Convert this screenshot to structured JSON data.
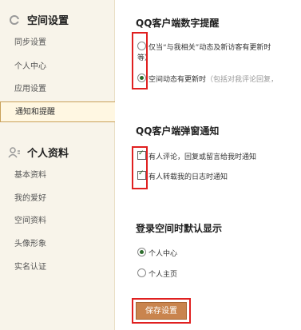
{
  "sidebar": {
    "space_settings": {
      "title": "空间设置",
      "items": [
        "同步设置",
        "个人中心",
        "应用设置",
        "通知和提醒"
      ]
    },
    "personal_info": {
      "title": "个人资料",
      "items": [
        "基本资料",
        "我的爱好",
        "空间资料",
        "头像形象",
        "实名认证"
      ]
    }
  },
  "main": {
    "digit_reminder": {
      "title": "QQ客户端数字提醒",
      "option1_text": "仅当“与我相关”动态及新访客有更新时",
      "option1_cont": "等）",
      "option2_text": "空间动态有更新时",
      "option2_note": "（包括对我评论回复，"
    },
    "popup": {
      "title": "QQ客户端弹窗通知",
      "check1": "有人评论，回复或留言给我时通知",
      "check2": "有人转载我的日志时通知"
    },
    "login_default": {
      "title": "登录空间时默认显示",
      "radio1": "个人中心",
      "radio2": "个人主页"
    },
    "save_label": "保存设置"
  },
  "colors": {
    "accent": "#c9844e",
    "highlight": "#e02020",
    "sidebar_bg": "#f8f4ea"
  }
}
